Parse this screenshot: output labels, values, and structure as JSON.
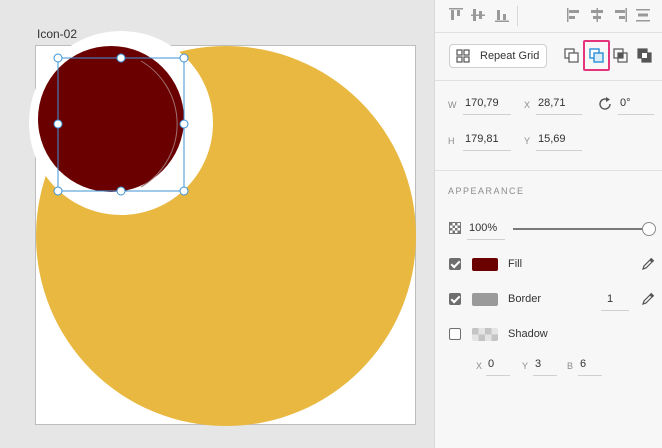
{
  "canvas": {
    "artboard_label": "Icon-02",
    "shapes": {
      "big_circle_color": "#e8b840",
      "white_circle_color": "#ffffff",
      "selected_circle_color": "#6a0000",
      "selection_color": "#3d93d6"
    }
  },
  "toolbar": {
    "align_buttons": [
      "align-top-icon",
      "align-middle-icon",
      "align-bottom-icon",
      "align-left-icon",
      "align-center-icon",
      "align-right-icon",
      "distribute-icon"
    ],
    "repeat_grid_label": "Repeat Grid",
    "boolean_buttons": [
      "add-icon",
      "subtract-icon",
      "intersect-icon",
      "exclude-icon"
    ],
    "highlight_color": "#e5347b"
  },
  "transform": {
    "w_label": "W",
    "w_value": "170,79",
    "x_label": "X",
    "x_value": "28,71",
    "rotation_value": "0°",
    "h_label": "H",
    "h_value": "179,81",
    "y_label": "Y",
    "y_value": "15,69"
  },
  "appearance": {
    "heading": "APPEARANCE",
    "opacity": "100%",
    "opacity_fraction": 1.0,
    "fill_label": "Fill",
    "fill_color": "#6a0000",
    "fill_checked": true,
    "border_label": "Border",
    "border_color": "#9a9a9a",
    "border_checked": true,
    "border_width": "1",
    "shadow_label": "Shadow",
    "shadow_checked": false,
    "shadow_x_label": "X",
    "shadow_x": "0",
    "shadow_y_label": "Y",
    "shadow_y": "3",
    "shadow_b_label": "B",
    "shadow_b": "6"
  }
}
